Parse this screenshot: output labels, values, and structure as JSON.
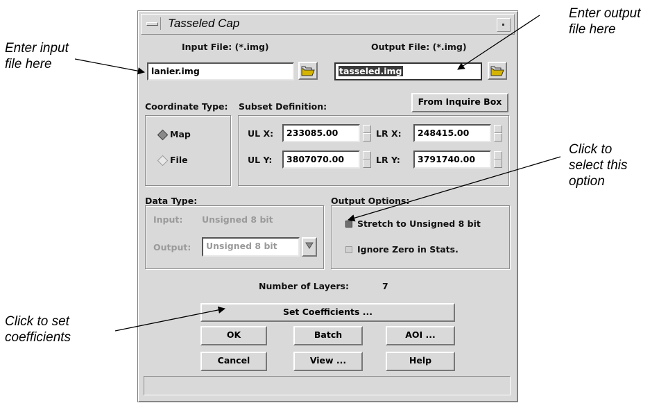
{
  "callouts": {
    "input": [
      "Enter input",
      "file here"
    ],
    "output": [
      "Enter output",
      "file here"
    ],
    "option": [
      "Click to",
      "select this",
      "option"
    ],
    "coefficients": [
      "Click to set",
      "coefficients"
    ]
  },
  "window": {
    "title": "Tasseled Cap"
  },
  "files": {
    "input_label": "Input File: (*.img)",
    "output_label": "Output File: (*.img)",
    "input_value": "lanier.img",
    "output_value": "tasseled.img"
  },
  "coord": {
    "label": "Coordinate Type:",
    "options": [
      "Map",
      "File"
    ],
    "selected": "Map"
  },
  "subset": {
    "label": "Subset Definition:",
    "from_inquire_label": "From Inquire Box",
    "ulx_label": "UL X:",
    "ulx": "233085.00",
    "lrx_label": "LR X:",
    "lrx": "248415.00",
    "uly_label": "UL Y:",
    "uly": "3807070.00",
    "lry_label": "LR Y:",
    "lry": "3791740.00"
  },
  "datatype": {
    "label": "Data Type:",
    "input_label": "Input:",
    "input_value": "Unsigned 8 bit",
    "output_label": "Output:",
    "output_value": "Unsigned 8 bit"
  },
  "output_options": {
    "label": "Output Options:",
    "stretch_label": "Stretch to Unsigned 8 bit",
    "stretch_checked": true,
    "ignore_zero_label": "Ignore Zero in Stats.",
    "ignore_zero_checked": false
  },
  "layers": {
    "label": "Number of Layers:",
    "value": "7"
  },
  "buttons": {
    "set_coefficients": "Set Coefficients ...",
    "ok": "OK",
    "batch": "Batch",
    "aoi": "AOI ...",
    "cancel": "Cancel",
    "view": "View ...",
    "help": "Help"
  },
  "colors": {
    "dialog_bg": "#d9d9d9",
    "radio_selected": "#8a8a8a",
    "check_on": "#6e6e6e"
  }
}
